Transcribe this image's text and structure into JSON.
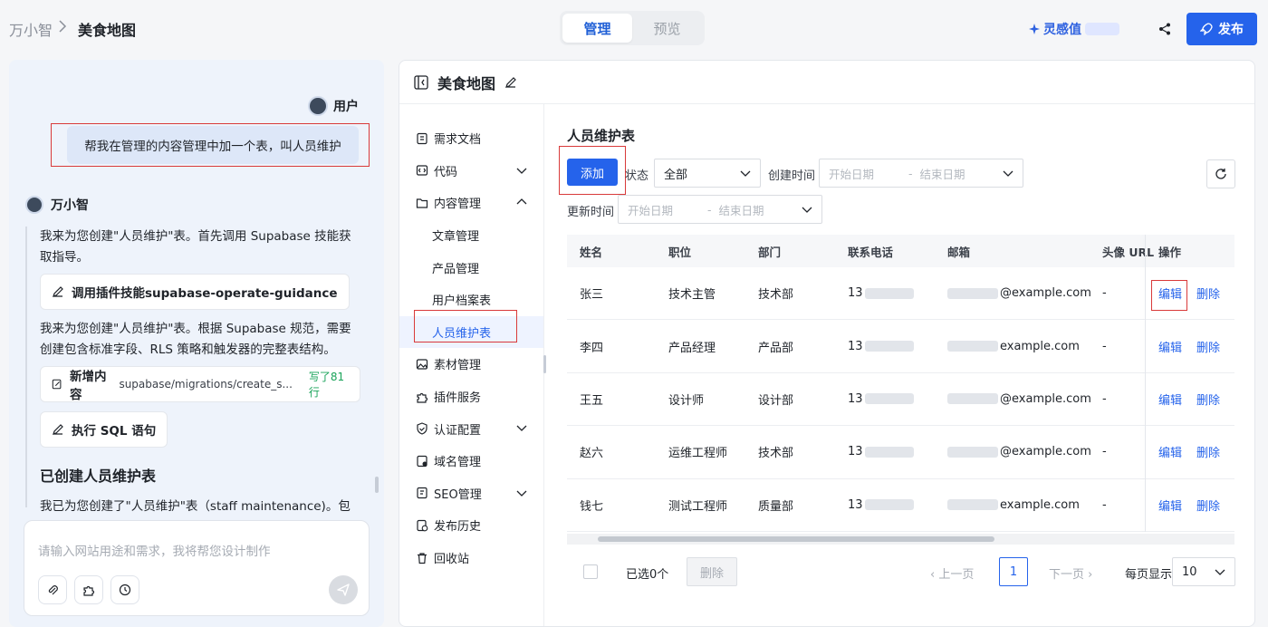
{
  "header": {
    "breadcrumb_parent": "万小智",
    "breadcrumb_current": "美食地图",
    "tabs": [
      "管理",
      "预览"
    ],
    "active_tab": 0,
    "inspire_label": "灵感值",
    "publish_label": "发布"
  },
  "chat": {
    "user_name": "用户",
    "user_message": "帮我在管理的内容管理中加一个表，叫人员维护",
    "bot_name": "万小智",
    "msg1": "我来为您创建\"人员维护\"表。首先调用 Supabase 技能获取指导。",
    "tool1_label": "调用插件技能supabase-operate-guidance",
    "msg2": "我来为您创建\"人员维护\"表。根据 Supabase 规范，需要创建包含标准字段、RLS 策略和触发器的完整表结构。",
    "tool2_label": "新增内容",
    "tool2_path": "supabase/migrations/create_s...",
    "tool2_status": "写了81行",
    "tool3_label": "执行 SQL 语句",
    "heading": "已创建人员维护表",
    "msg3": "我已为您创建了\"人员维护\"表（staff maintenance)。包",
    "input_placeholder": "请输入网站用途和需求，我将帮您设计制作"
  },
  "manage": {
    "title": "美食地图",
    "nav": [
      {
        "label": "需求文档",
        "icon": "document-icon",
        "chevron": ""
      },
      {
        "label": "代码",
        "icon": "code-icon",
        "chevron": "down"
      },
      {
        "label": "内容管理",
        "icon": "folder-icon",
        "chevron": "up"
      },
      {
        "label": "文章管理",
        "icon": "",
        "chevron": ""
      },
      {
        "label": "产品管理",
        "icon": "",
        "chevron": ""
      },
      {
        "label": "用户档案表",
        "icon": "",
        "chevron": ""
      },
      {
        "label": "人员维护表",
        "icon": "",
        "chevron": ""
      },
      {
        "label": "素材管理",
        "icon": "image-icon",
        "chevron": ""
      },
      {
        "label": "插件服务",
        "icon": "puzzle-icon",
        "chevron": ""
      },
      {
        "label": "认证配置",
        "icon": "shield-icon",
        "chevron": "down"
      },
      {
        "label": "域名管理",
        "icon": "domain-icon",
        "chevron": ""
      },
      {
        "label": "SEO管理",
        "icon": "seo-icon",
        "chevron": "down"
      },
      {
        "label": "发布历史",
        "icon": "history-doc-icon",
        "chevron": ""
      },
      {
        "label": "回收站",
        "icon": "trash-icon",
        "chevron": ""
      }
    ],
    "active_nav": 6,
    "section_title": "人员维护表",
    "add_label": "添加",
    "status_label": "状态",
    "status_value": "全部",
    "created_label": "创建时间",
    "updated_label": "更新时间",
    "start_placeholder": "开始日期",
    "end_placeholder": "结束日期",
    "range_sep": "-",
    "columns": [
      "姓名",
      "职位",
      "部门",
      "联系电话",
      "邮箱",
      "头像 URL",
      "操作"
    ],
    "rows": [
      {
        "name": "张三",
        "position": "技术主管",
        "dept": "技术部",
        "phone": "13",
        "email": "@example.com",
        "avatar": "-"
      },
      {
        "name": "李四",
        "position": "产品经理",
        "dept": "产品部",
        "phone": "13",
        "email": "example.com",
        "avatar": "-"
      },
      {
        "name": "王五",
        "position": "设计师",
        "dept": "设计部",
        "phone": "13",
        "email": "@example.com",
        "avatar": "-"
      },
      {
        "name": "赵六",
        "position": "运维工程师",
        "dept": "技术部",
        "phone": "13",
        "email": "@example.com",
        "avatar": "-"
      },
      {
        "name": "钱七",
        "position": "测试工程师",
        "dept": "质量部",
        "phone": "13",
        "email": "example.com",
        "avatar": "-"
      }
    ],
    "edit_label": "编辑",
    "delete_label": "删除",
    "selected_text": "已选0个",
    "batch_delete_label": "删除",
    "prev_label": "上一页",
    "next_label": "下一页",
    "current_page": "1",
    "per_page_label": "每页显示",
    "per_page_value": "10"
  },
  "colors": {
    "accent": "#2563eb",
    "highlight_box": "#d93a3a",
    "success": "#1aa35a"
  }
}
